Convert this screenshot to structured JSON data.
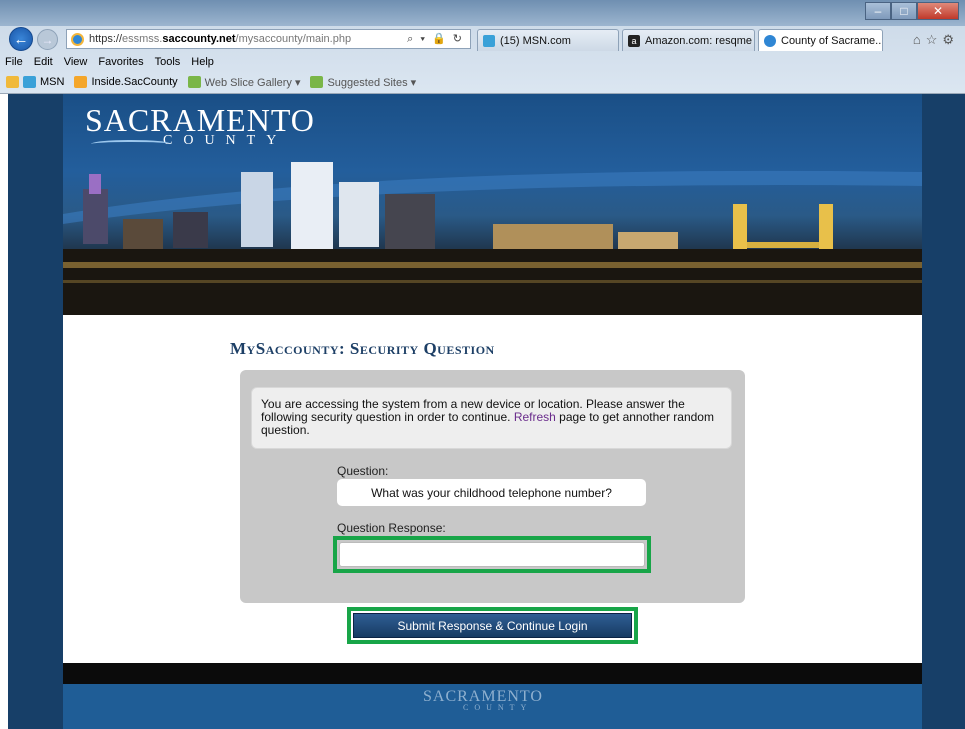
{
  "browser": {
    "url": {
      "scheme": "https://",
      "sub": "essmss.",
      "domain": "saccounty.net",
      "path": "/mysaccounty/main.php"
    },
    "tabs": [
      {
        "label": "(15) MSN.com"
      },
      {
        "label": "Amazon.com: resqme ..."
      },
      {
        "label": "County of Sacrame...",
        "close": "×"
      }
    ],
    "menu": [
      "File",
      "Edit",
      "View",
      "Favorites",
      "Tools",
      "Help"
    ],
    "favorites": [
      {
        "label": "MSN"
      },
      {
        "label": "Inside.SacCounty"
      },
      {
        "label": "Web Slice Gallery ▾"
      },
      {
        "label": "Suggested Sites ▾"
      }
    ]
  },
  "banner": {
    "logo_main": "SACRAMENTO",
    "logo_sub": "COUNTY"
  },
  "page": {
    "heading": "MySaccounty: Security Question",
    "notice": {
      "text_before": "You are accessing the system from a new device or location. Please answer the following security question in order to continue. ",
      "link": "Refresh",
      "text_after": " page to get annother random question."
    },
    "question_label": "Question:",
    "question": "What was your childhood telephone number?",
    "response_label": "Question Response:",
    "response_value": "",
    "submit_label": "Submit Response & Continue Login"
  },
  "footer": {
    "logo_main": "SACRAMENTO",
    "logo_sub": "COUNTY"
  },
  "colors": {
    "brand_navy": "#1d3f66",
    "highlight_green": "#18a548",
    "page_bg": "#173f68"
  }
}
